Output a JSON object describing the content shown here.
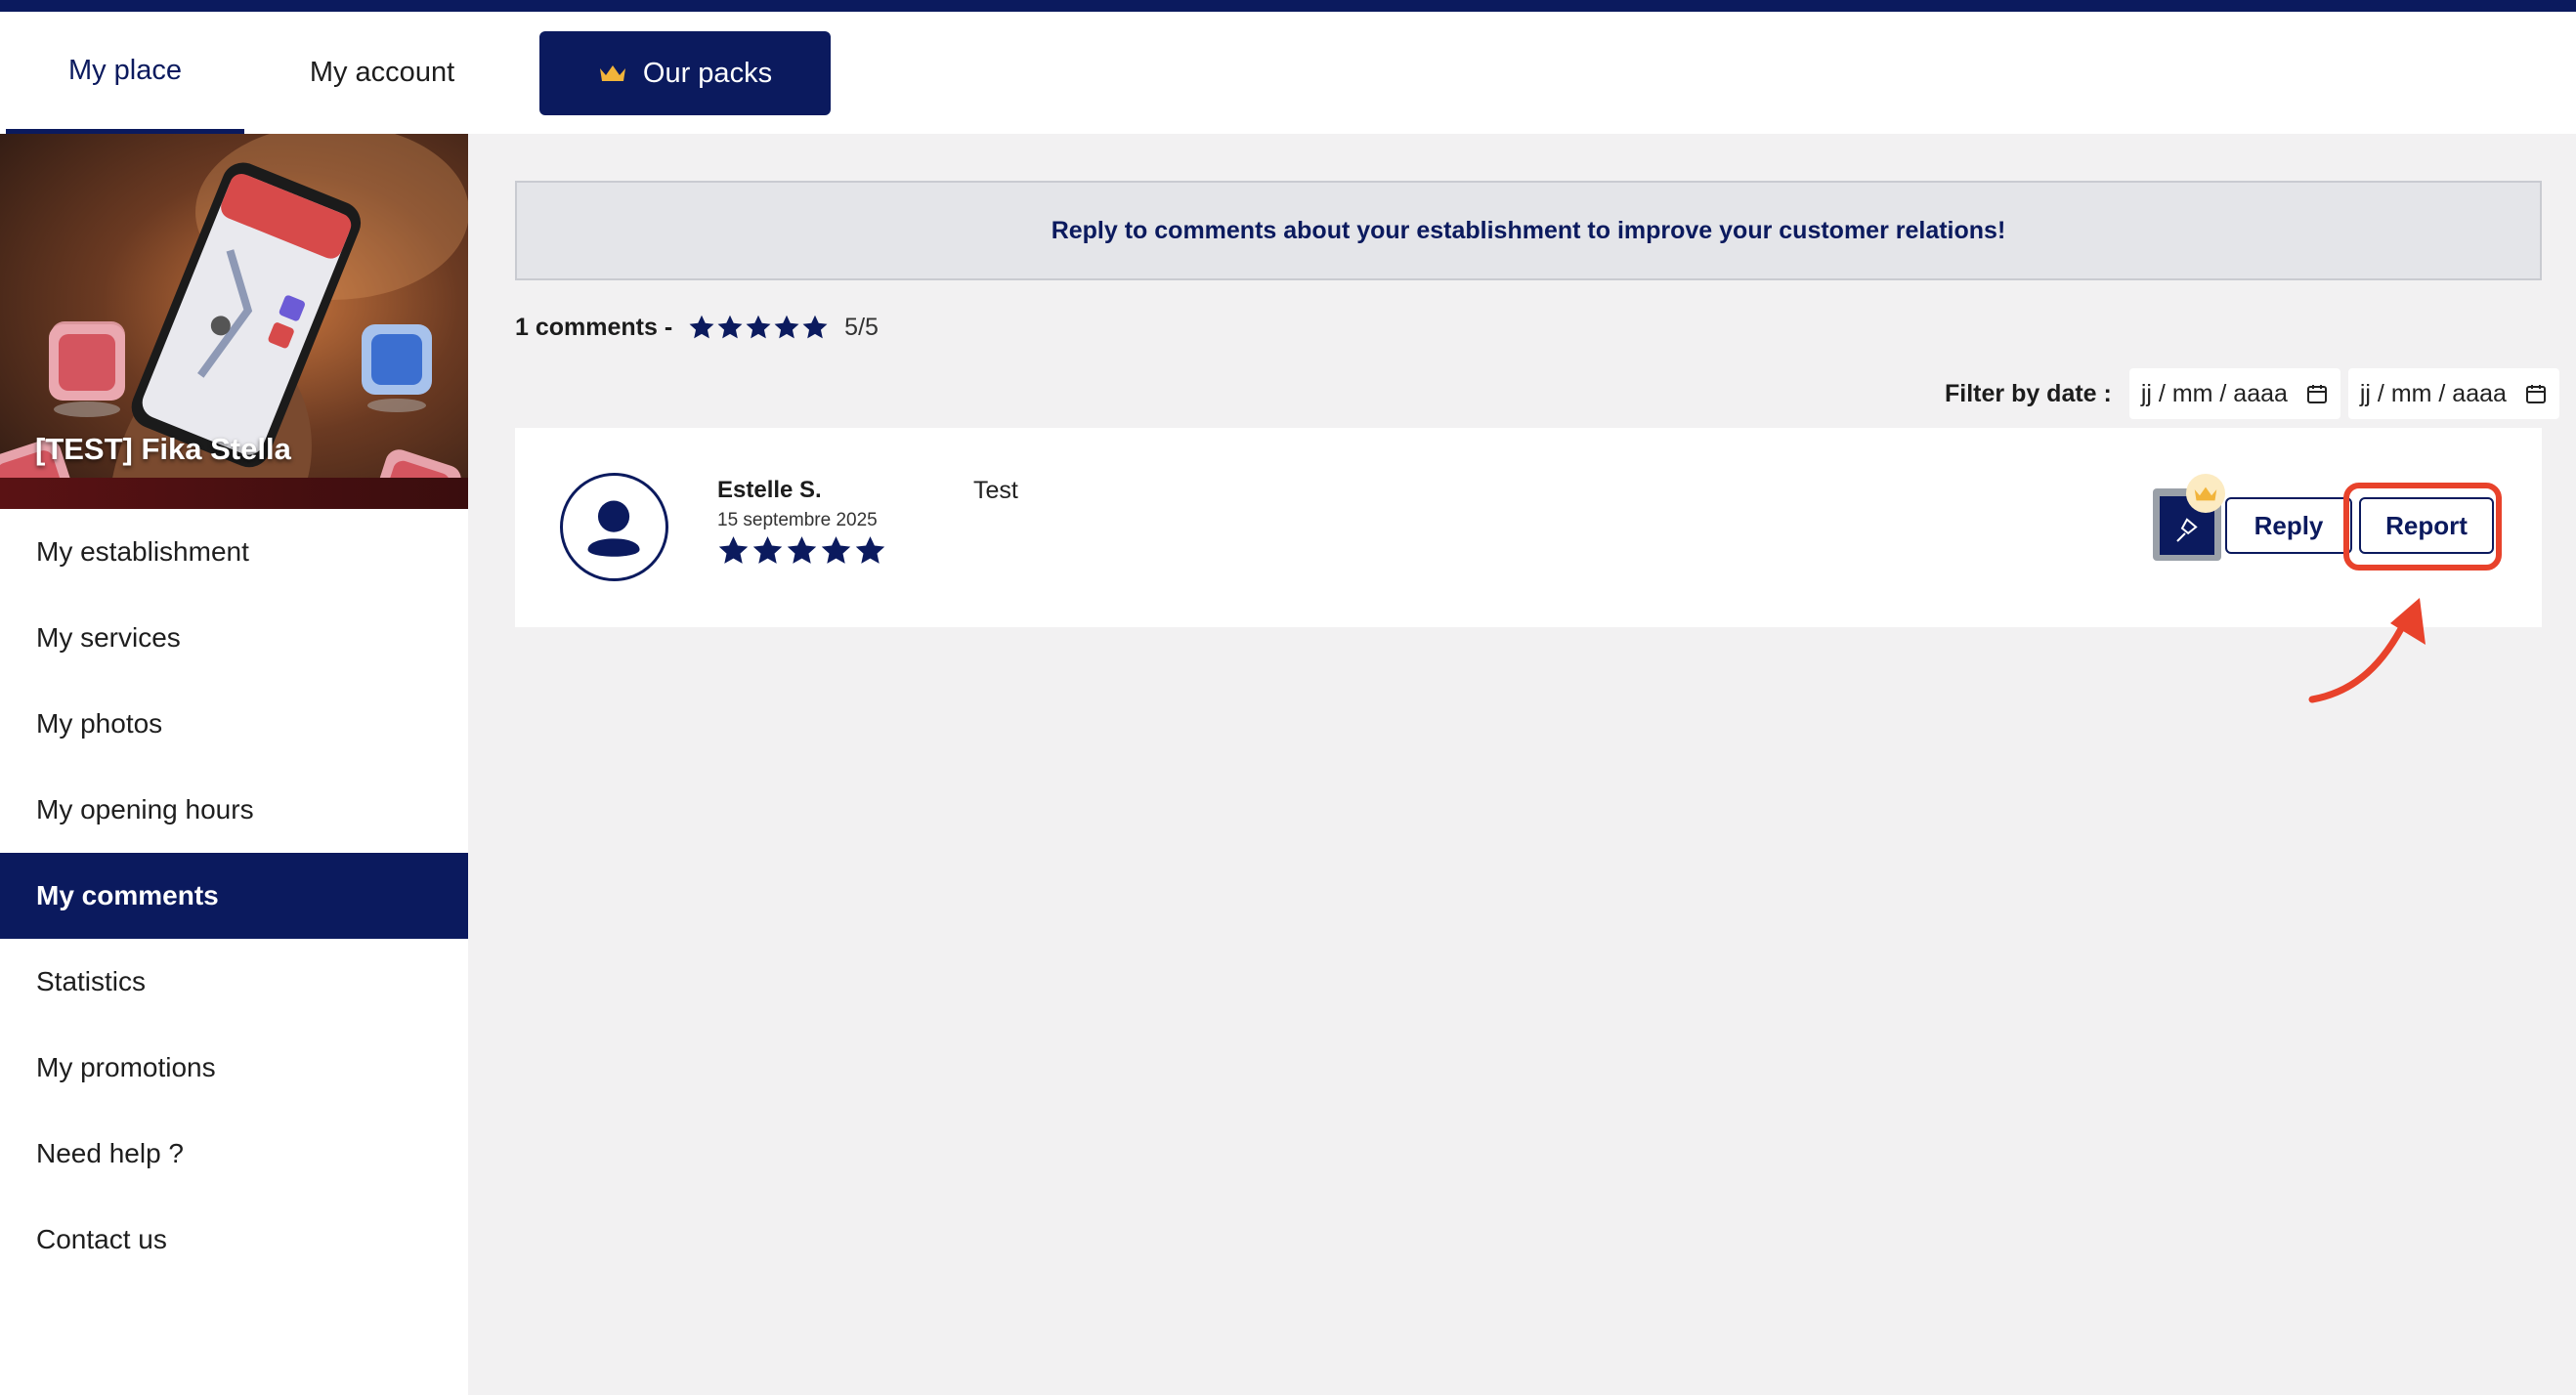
{
  "nav": {
    "tabs": [
      {
        "label": "My place",
        "active": true
      },
      {
        "label": "My account",
        "active": false
      }
    ],
    "packs_label": "Our packs",
    "packs_icon": "crown-icon"
  },
  "sidebar": {
    "place_name": "[TEST] Fika Stella",
    "items": [
      {
        "label": "My establishment"
      },
      {
        "label": "My services"
      },
      {
        "label": "My photos"
      },
      {
        "label": "My opening hours"
      },
      {
        "label": "My comments",
        "active": true
      },
      {
        "label": "Statistics"
      },
      {
        "label": "My promotions"
      },
      {
        "label": "Need help ?"
      },
      {
        "label": "Contact us"
      }
    ]
  },
  "main": {
    "banner": "Reply to comments about your establishment to improve your customer relations!",
    "summary": {
      "count_text": "1 comments -",
      "stars": 5,
      "rating_text": "5/5"
    },
    "filter": {
      "label": "Filter by date :",
      "from_placeholder": "jj / mm / aaaa",
      "to_placeholder": "jj / mm / aaaa"
    },
    "comments": [
      {
        "author": "Estelle S.",
        "date": "15 septembre 2025",
        "stars": 5,
        "text": "Test",
        "reply_label": "Reply",
        "report_label": "Report"
      }
    ]
  },
  "colors": {
    "brand": "#0b1a5e",
    "highlight": "#e8422b",
    "crown": "#f2b43a",
    "background": "#f2f1f2"
  }
}
